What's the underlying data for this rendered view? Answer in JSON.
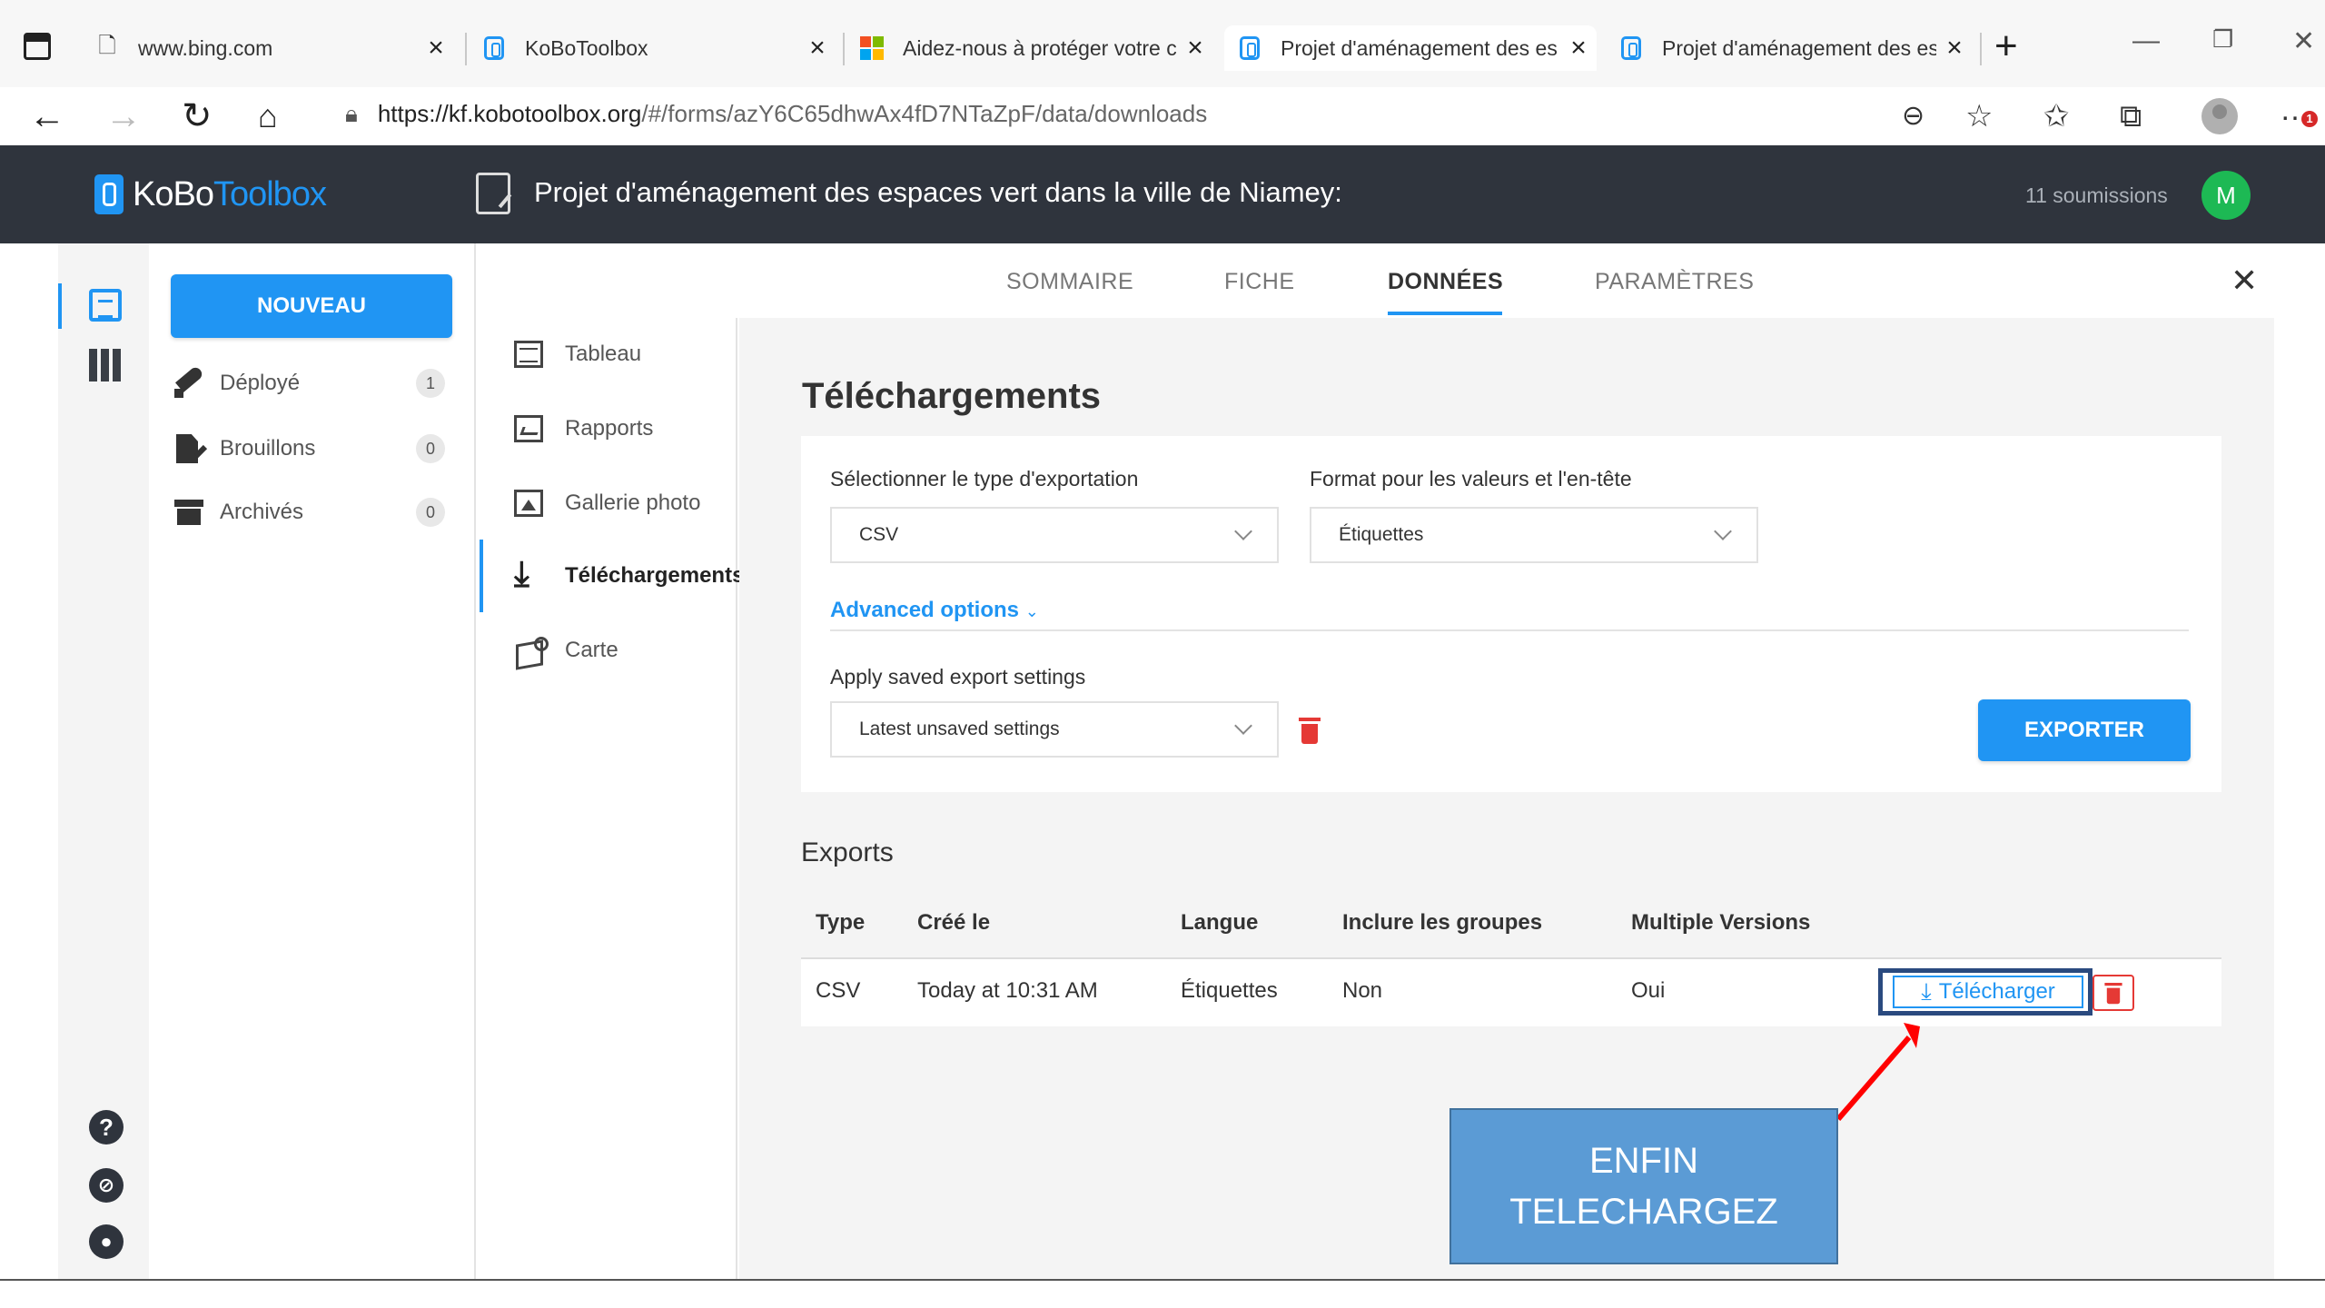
{
  "browser": {
    "tabs": [
      {
        "title": "www.bing.com"
      },
      {
        "title": "KoBoToolbox"
      },
      {
        "title": "Aidez-nous à protéger votre c"
      },
      {
        "title": "Projet d'aménagement des es"
      },
      {
        "title": "Projet d'aménagement des es"
      }
    ],
    "url_host": "https://kf.kobotoolbox.org",
    "url_path": "/#/forms/azY6C65dhwAx4fD7NTaZpF/data/downloads",
    "notification_count": "1"
  },
  "header": {
    "logo_part1": "KoBo",
    "logo_part2": "Toolbox",
    "project_title": "Projet d'aménagement des  espaces vert dans la ville de Niamey:",
    "submissions": "11 soumissions",
    "user_initial": "M"
  },
  "sidebar": {
    "new_button": "NOUVEAU",
    "items": [
      {
        "label": "Déployé",
        "count": "1"
      },
      {
        "label": "Brouillons",
        "count": "0"
      },
      {
        "label": "Archivés",
        "count": "0"
      }
    ]
  },
  "tabs": {
    "summary": "SOMMAIRE",
    "form": "FICHE",
    "data": "DONNÉES",
    "settings": "PARAMÈTRES"
  },
  "data_nav": {
    "items": [
      {
        "label": "Tableau"
      },
      {
        "label": "Rapports"
      },
      {
        "label": "Gallerie photo"
      },
      {
        "label": "Téléchargements"
      },
      {
        "label": "Carte"
      }
    ]
  },
  "downloads": {
    "title": "Téléchargements",
    "export_type_label": "Sélectionner le type d'exportation",
    "export_type_value": "CSV",
    "format_label": "Format pour les valeurs et l'en-tête",
    "format_value": "Étiquettes",
    "advanced_options": "Advanced options",
    "saved_settings_label": "Apply saved export settings",
    "saved_settings_value": "Latest unsaved settings",
    "export_button": "EXPORTER"
  },
  "exports": {
    "title": "Exports",
    "columns": [
      "Type",
      "Créé le",
      "Langue",
      "Inclure les groupes",
      "Multiple Versions"
    ],
    "rows": [
      {
        "type": "CSV",
        "created": "Today at 10:31 AM",
        "language": "Étiquettes",
        "groups": "Non",
        "versions": "Oui",
        "download": "Télécharger"
      }
    ]
  },
  "annotation": {
    "line1": "ENFIN",
    "line2": "TELECHARGEZ"
  },
  "colors": {
    "accent": "#2095f3",
    "header_bg": "#2f343d",
    "danger": "#e53935",
    "annotation_bg": "#5b9bd5",
    "arrow": "#ff0000"
  }
}
